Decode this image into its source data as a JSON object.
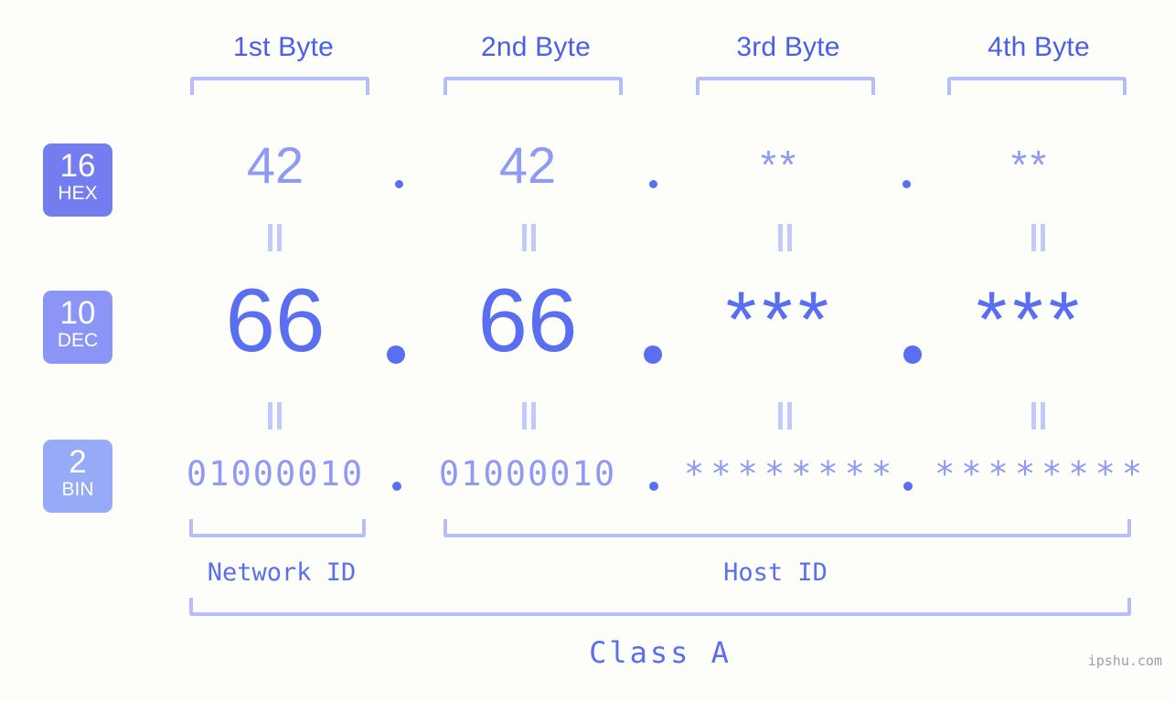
{
  "meta": {
    "watermark": "ipshu.com",
    "background_color": "#fdfdfa",
    "accent_color": "#5a6ef0",
    "accent_light_color": "#8f9af4",
    "bracket_color": "#b6bef9"
  },
  "headers": [
    {
      "label": "1st Byte"
    },
    {
      "label": "2nd Byte"
    },
    {
      "label": "3rd Byte"
    },
    {
      "label": "4th Byte"
    }
  ],
  "bases": [
    {
      "number": "16",
      "abbr": "HEX",
      "color": "#737df0"
    },
    {
      "number": "10",
      "abbr": "DEC",
      "color": "#8b95f5"
    },
    {
      "number": "2",
      "abbr": "BIN",
      "color": "#97aaf7"
    }
  ],
  "rows": {
    "hex": {
      "values": [
        "42",
        "42",
        "**",
        "**"
      ],
      "separator": "."
    },
    "dec": {
      "values": [
        "66",
        "66",
        "***",
        "***"
      ],
      "separator": "."
    },
    "bin": {
      "values": [
        "01000010",
        "01000010",
        "********",
        "********"
      ],
      "separator": "."
    }
  },
  "separators": {
    "equals_glyph": "=",
    "count_per_row": 4
  },
  "segments": [
    {
      "name": "Network ID",
      "label": "Network ID"
    },
    {
      "name": "Host ID",
      "label": "Host ID"
    }
  ],
  "class": {
    "label": "Class A"
  }
}
